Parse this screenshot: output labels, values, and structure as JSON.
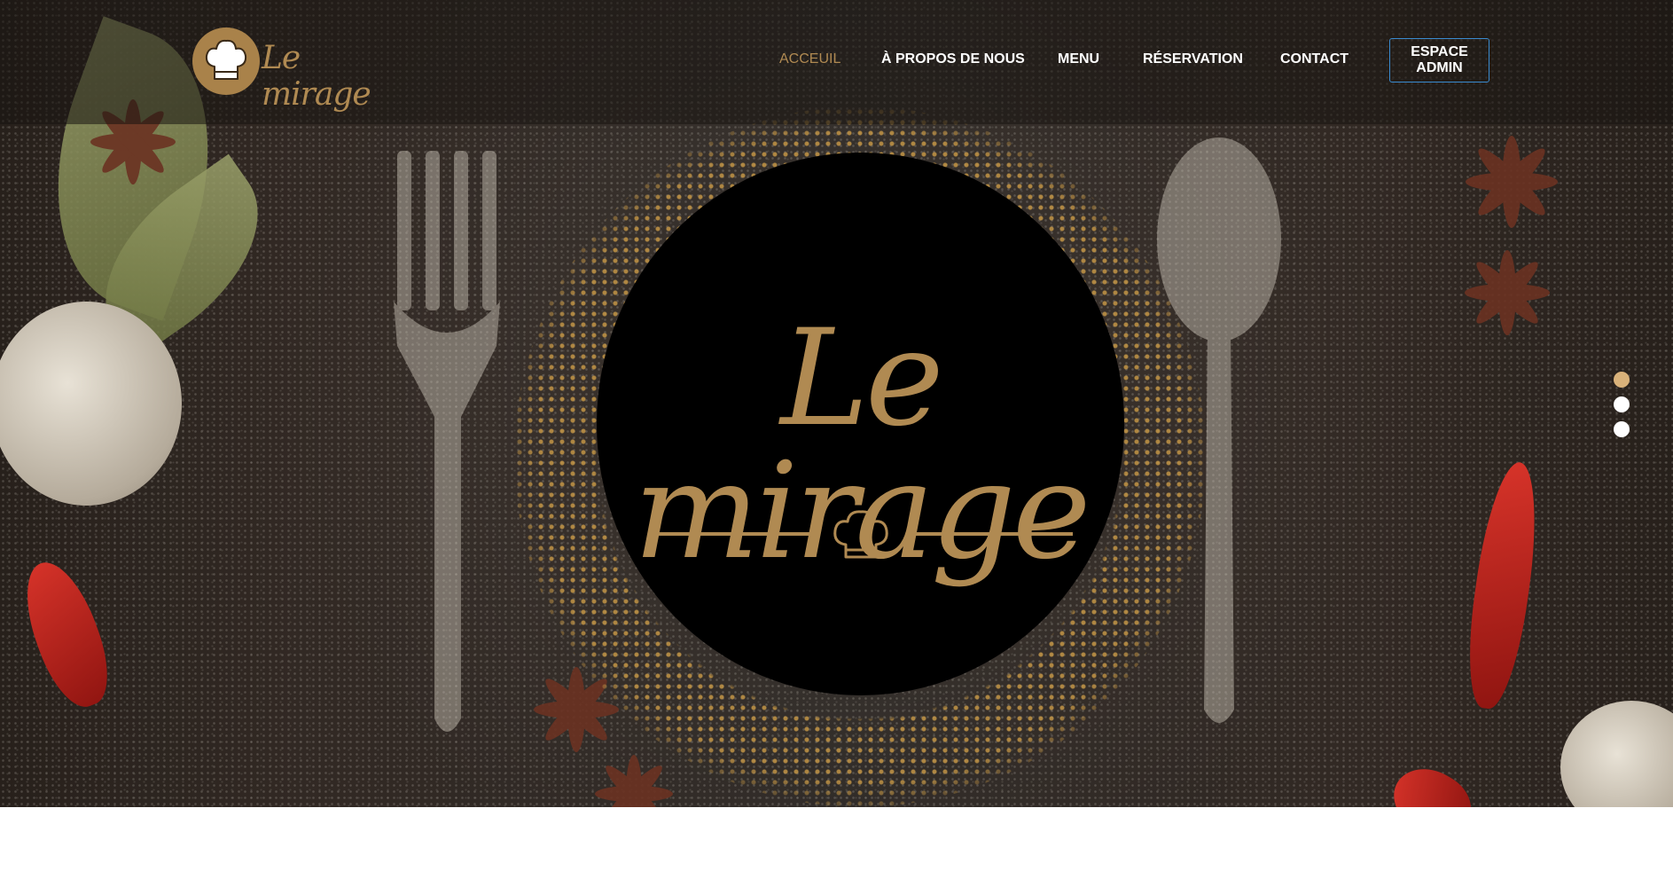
{
  "brand": {
    "logo_text": "Le mirage",
    "hero_text": "Le mirage",
    "accent_color": "#b08a52"
  },
  "nav": {
    "items": [
      {
        "label": "ACCEUIL",
        "active": true
      },
      {
        "label": "À PROPOS DE NOUS",
        "active": false
      },
      {
        "label": "MENU",
        "active": false
      },
      {
        "label": "RÉSERVATION",
        "active": false
      },
      {
        "label": "CONTACT",
        "active": false
      }
    ],
    "admin_label": "ESPACE ADMIN"
  },
  "slider": {
    "slide_count": 3,
    "active_index": 0
  },
  "icons": {
    "logo": "chef-hat-icon",
    "plate": "chef-hat-icon"
  }
}
